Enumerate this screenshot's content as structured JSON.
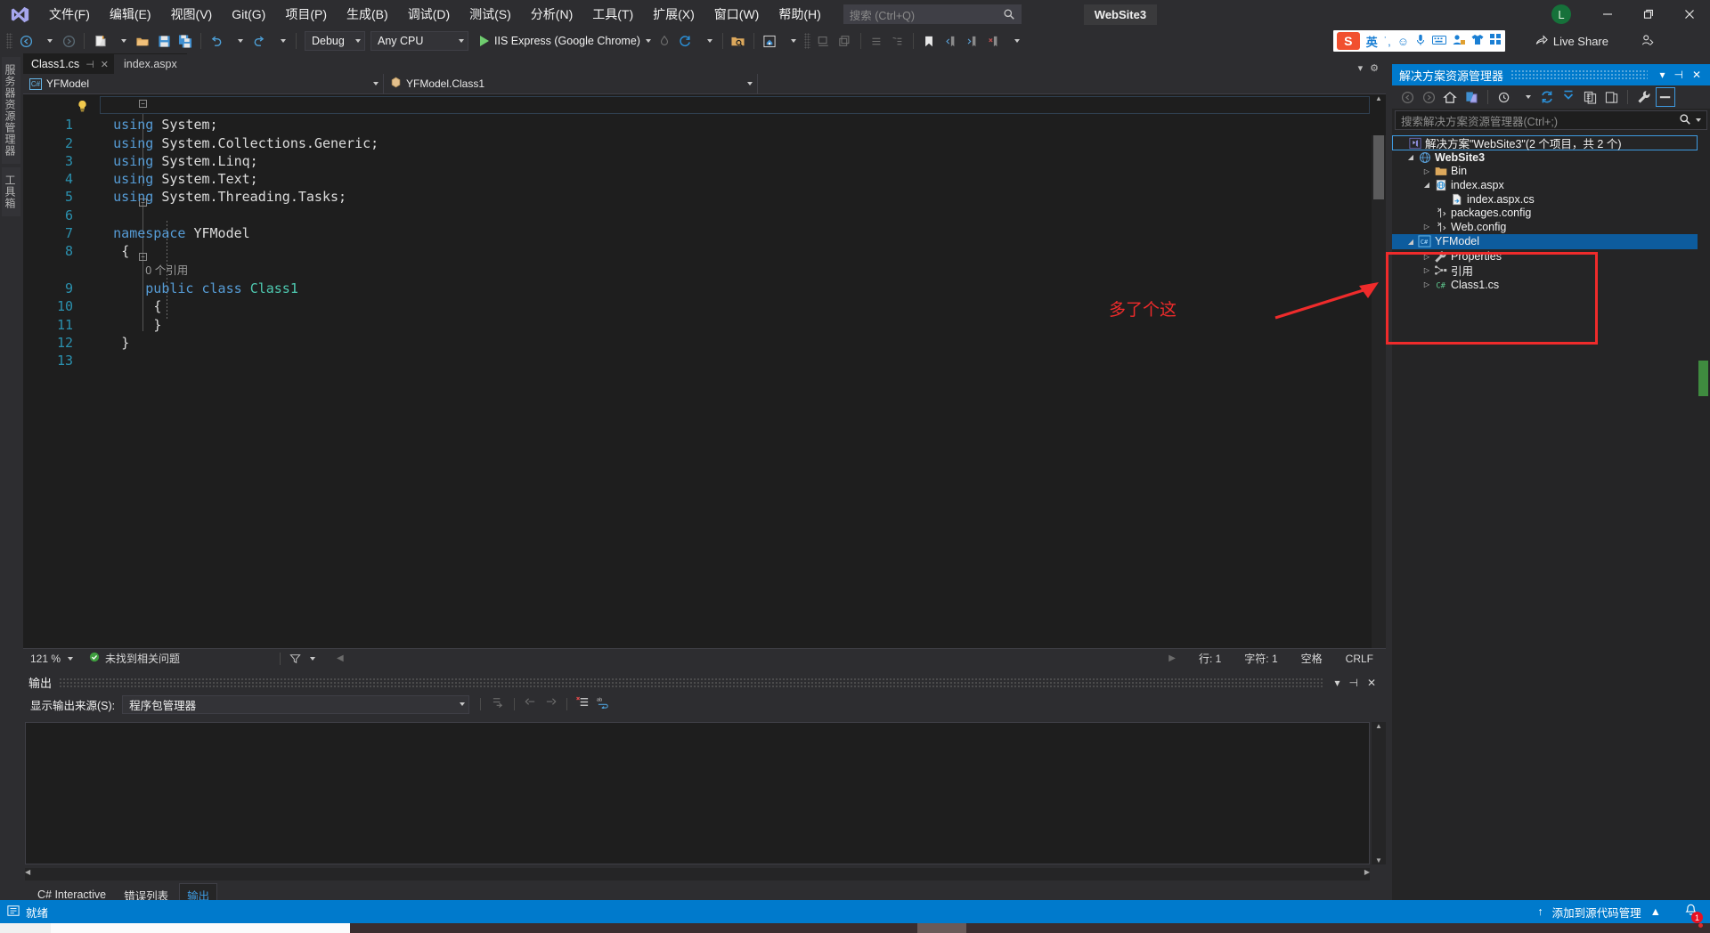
{
  "titlebar": {
    "logo_icon": "visual-studio-logo",
    "menu": [
      {
        "label": "文件(F)"
      },
      {
        "label": "编辑(E)"
      },
      {
        "label": "视图(V)"
      },
      {
        "label": "Git(G)"
      },
      {
        "label": "项目(P)"
      },
      {
        "label": "生成(B)"
      },
      {
        "label": "调试(D)"
      },
      {
        "label": "测试(S)"
      },
      {
        "label": "分析(N)"
      },
      {
        "label": "工具(T)"
      },
      {
        "label": "扩展(X)"
      },
      {
        "label": "窗口(W)"
      },
      {
        "label": "帮助(H)"
      }
    ],
    "search_placeholder": "搜索 (Ctrl+Q)",
    "project_name": "WebSite3",
    "avatar_letter": "L",
    "minimize_icon": "minimize-icon",
    "restore_icon": "restore-icon",
    "close_icon": "close-icon"
  },
  "toolbar": {
    "back_icon": "navigate-back-icon",
    "forward_icon": "navigate-forward-icon",
    "new_project_icon": "new-project-icon",
    "open_icon": "open-file-icon",
    "save_icon": "save-icon",
    "save_all_icon": "save-all-icon",
    "undo_icon": "undo-icon",
    "redo_icon": "redo-icon",
    "configuration": "Debug",
    "platform": "Any CPU",
    "start_label": "IIS Express (Google Chrome)",
    "hot_reload_icon": "hot-reload-icon",
    "refresh_icon": "refresh-icon",
    "folder_search_icon": "folder-search-icon",
    "preview_icon": "live-preview-icon",
    "indent_icons": [
      "indent-decrease-icon",
      "indent-increase-icon"
    ],
    "bookmark_icon": "bookmark-icon",
    "live_share_label": "Live Share",
    "live_share_icon": "live-share-icon",
    "share_people_icon": "share-people-icon"
  },
  "ime": {
    "brand_icon": "sogou-ime-icon",
    "mode": "英",
    "punct_icon": "punctuation-icon",
    "emoji_icon": "emoji-icon",
    "mic_icon": "microphone-icon",
    "keyboard_icon": "soft-keyboard-icon",
    "user_icon": "user-icon",
    "skin_icon": "skin-icon",
    "apps_icon": "toolbox-icon"
  },
  "left_tabs": [
    {
      "label": "服务器资源管理器"
    },
    {
      "label": "工具箱"
    }
  ],
  "editor": {
    "tabs": [
      {
        "label": "Class1.cs",
        "active": true,
        "pin_icon": "pin-icon",
        "close_icon": "close-icon"
      },
      {
        "label": "index.aspx",
        "active": false
      }
    ],
    "nav_left": "YFModel",
    "nav_left_icon": "csharp-file-icon",
    "nav_right": "YFModel.Class1",
    "nav_right_icon": "class-member-icon",
    "bulb_icon": "lightbulb-icon",
    "codelens": "0 个引用",
    "lines": [
      {
        "n": "1",
        "text": "using System;"
      },
      {
        "n": "2",
        "text": "using System.Collections.Generic;"
      },
      {
        "n": "3",
        "text": "using System.Linq;"
      },
      {
        "n": "4",
        "text": "using System.Text;"
      },
      {
        "n": "5",
        "text": "using System.Threading.Tasks;"
      },
      {
        "n": "6",
        "text": ""
      },
      {
        "n": "7",
        "text": "namespace YFModel"
      },
      {
        "n": "8",
        "text": "{"
      },
      {
        "n": "9",
        "text": "    public class Class1"
      },
      {
        "n": "10",
        "text": "    {"
      },
      {
        "n": "11",
        "text": "    }"
      },
      {
        "n": "12",
        "text": "}"
      },
      {
        "n": "13",
        "text": ""
      }
    ],
    "status": {
      "zoom": "121 %",
      "issues": "未找到相关问题",
      "issues_icon": "check-circle-icon",
      "filter_icon": "filter-icon",
      "line": "行: 1",
      "column": "字符: 1",
      "spaces": "空格",
      "eol": "CRLF"
    }
  },
  "output_panel": {
    "title": "输出",
    "dropdown_icon": "chevron-down-icon",
    "pin_icon": "pin-icon",
    "close_icon": "close-icon",
    "source_label": "显示输出来源(S):",
    "source_value": "程序包管理器",
    "tool_icons": [
      "output-jump-icon",
      "output-prev-icon",
      "output-next-icon",
      "clear-output-icon",
      "word-wrap-icon"
    ],
    "body_text": ""
  },
  "bottom_tabs": [
    {
      "label": "C# Interactive",
      "active": false
    },
    {
      "label": "错误列表",
      "active": false
    },
    {
      "label": "输出",
      "active": true
    }
  ],
  "solution_explorer": {
    "title": "解决方案资源管理器",
    "menu_icon": "chevron-down-icon",
    "pin_icon": "pin-icon",
    "close_icon": "close-icon",
    "toolbar_icons": [
      "nav-back-icon",
      "nav-forward-icon",
      "home-icon",
      "sync-with-active-document-icon",
      "pending-changes-icon",
      "refresh-icon",
      "collapse-all-icon",
      "show-all-files-icon",
      "view-designer-icon",
      "properties-icon",
      "preview-selected-items-icon"
    ],
    "search_placeholder": "搜索解决方案资源管理器(Ctrl+;)",
    "search_icon": "search-icon",
    "tree": [
      {
        "label": "解决方案\"WebSite3\"(2 个项目，共 2 个)",
        "indent": 0,
        "arrow": "",
        "icon": "solution-icon",
        "bold": false,
        "outlined": true
      },
      {
        "label": "WebSite3",
        "indent": 1,
        "arrow": "▲",
        "icon": "website-icon",
        "bold": true,
        "outlined": false
      },
      {
        "label": "Bin",
        "indent": 2,
        "arrow": "▶",
        "icon": "folder-icon",
        "bold": false,
        "outlined": false
      },
      {
        "label": "index.aspx",
        "indent": 2,
        "arrow": "▲",
        "icon": "aspx-page-icon",
        "bold": false,
        "outlined": false
      },
      {
        "label": "index.aspx.cs",
        "indent": 3,
        "arrow": "",
        "icon": "codebehind-icon",
        "bold": false,
        "outlined": false
      },
      {
        "label": "packages.config",
        "indent": 2,
        "arrow": "",
        "icon": "config-file-icon",
        "bold": false,
        "outlined": false
      },
      {
        "label": "Web.config",
        "indent": 2,
        "arrow": "▶",
        "icon": "config-file-icon",
        "bold": false,
        "outlined": false
      },
      {
        "label": "YFModel",
        "indent": 1,
        "arrow": "▲",
        "icon": "csharp-project-icon",
        "bold": false,
        "outlined": false,
        "selected": true
      },
      {
        "label": "Properties",
        "indent": 2,
        "arrow": "▶",
        "icon": "properties-icon",
        "bold": false,
        "outlined": false
      },
      {
        "label": "引用",
        "indent": 2,
        "arrow": "▶",
        "icon": "references-icon",
        "bold": false,
        "outlined": false
      },
      {
        "label": "Class1.cs",
        "indent": 2,
        "arrow": "▶",
        "icon": "csharp-file-icon",
        "bold": false,
        "outlined": false
      }
    ]
  },
  "annotation": {
    "text": "多了个这",
    "color": "#ef2b2b",
    "arrow_icon": "red-arrow-icon",
    "box_icon": "red-highlight-box"
  },
  "statusbar": {
    "ready": "就绪",
    "ready_icon": "source-control-icon",
    "add_to_source_control": "添加到源代码管理",
    "upload_icon": "upload-arrow-icon",
    "chevron_icon": "chevron-up-icon",
    "bell_icon": "notification-bell-icon",
    "bell_count": "1"
  },
  "colors": {
    "accent": "#007acc",
    "annotation_red": "#ef2b2b",
    "editor_bg": "#1e1e1e",
    "chrome_bg": "#2d2d30",
    "selection_blue": "#0d5c9e"
  }
}
